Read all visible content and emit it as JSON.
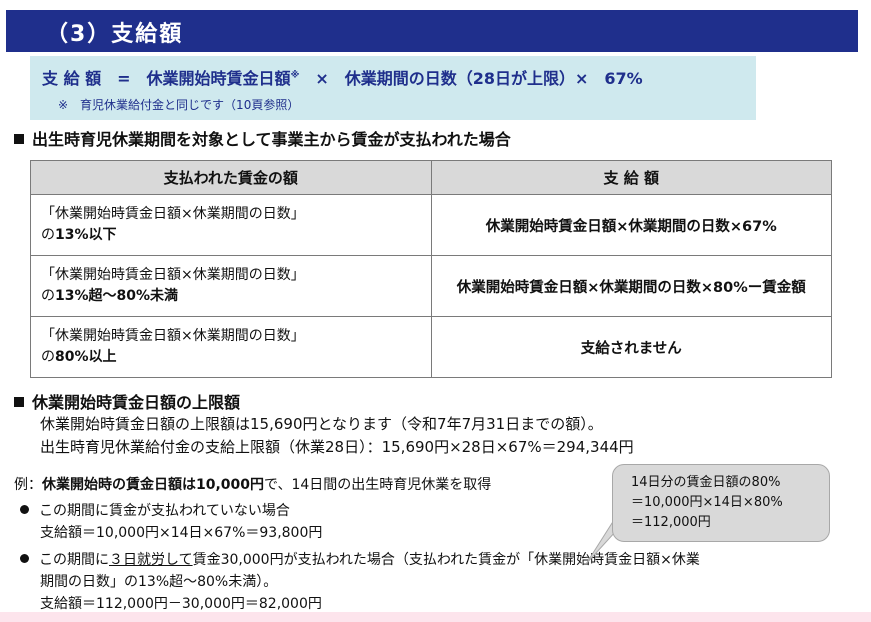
{
  "header": {
    "title": "（3）支給額"
  },
  "formula": {
    "text": "支 給 額　=　休業開始時賃金日額",
    "mark": "※",
    "text_rest": "　×　休業期間の日数（28日が上限）×　67%",
    "note": "※　育児休業給付金と同じです（10頁参照）"
  },
  "section1": {
    "heading": "出生時育児休業期間を対象として事業主から賃金が支払われた場合",
    "table": {
      "headers": [
        "支払われた賃金の額",
        "支 給 額"
      ],
      "rows": [
        {
          "cond_line1": "「休業開始時賃金日額×休業期間の日数」",
          "cond_prefix": "の",
          "cond_bold": "13%以下",
          "amount": "休業開始時賃金日額×休業期間の日数×67%"
        },
        {
          "cond_line1": "「休業開始時賃金日額×休業期間の日数」",
          "cond_prefix": "の",
          "cond_bold": "13%超～80%未満",
          "amount": "休業開始時賃金日額×休業期間の日数×80%ー賃金額"
        },
        {
          "cond_line1": "「休業開始時賃金日額×休業期間の日数」",
          "cond_prefix": "の",
          "cond_bold": "80%以上",
          "amount": "支給されません"
        }
      ]
    }
  },
  "section2": {
    "heading": "休業開始時賃金日額の上限額",
    "line1": "休業開始時賃金日額の上限額は15,690円となります（令和7年7月31日までの額）。",
    "line2": "出生時育児休業給付金の支給上限額（休業28日）：15,690円×28日×67%＝294,344円"
  },
  "example": {
    "prefix": "例：",
    "bold": "休業開始時の賃金日額は10,000円",
    "rest": "で、14日間の出生時育児休業を取得",
    "case1": {
      "text": "この期間に賃金が支払われていない場合",
      "calc": "支給額＝10,000円×14日×67%＝93,800円"
    },
    "case2": {
      "pre": "この期間に",
      "underlined": "３日就労して",
      "post": "賃金30,000円が支払われた場合（支払われた賃金が「休業開始時賃金日額×休業",
      "line2": "期間の日数」の13%超～80%未満）。",
      "calc": "支給額＝112,000円－30,000円＝82,000円"
    }
  },
  "callout": {
    "line1": "14日分の賃金日額の80%",
    "line2": "＝10,000円×14日×80%",
    "line3": "＝112,000円"
  },
  "colors": {
    "header_bg": "#1f2f8c",
    "formula_bg": "#cfe9ee",
    "table_header_bg": "#d9d9d9",
    "callout_bg": "#d9d9d9"
  }
}
